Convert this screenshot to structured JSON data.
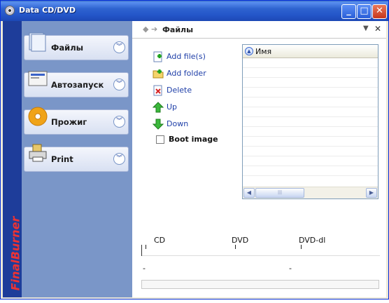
{
  "window": {
    "title": "Data CD/DVD",
    "controls": {
      "minimize": "_",
      "maximize": "□",
      "close": "✕"
    }
  },
  "brand": {
    "name": "FinalBurner",
    "strip_color": "#1e3d9a",
    "text_color": "#e33333"
  },
  "sidebar": {
    "items": [
      {
        "label": "Файлы",
        "icon": "files-icon"
      },
      {
        "label": "Автозапуск",
        "icon": "autorun-icon"
      },
      {
        "label": "Прожиг",
        "icon": "burn-disc-icon"
      },
      {
        "label": "Print",
        "icon": "printer-icon"
      }
    ]
  },
  "panel": {
    "title": "Файлы",
    "actions": [
      {
        "label": "Add file(s)",
        "icon": "add-file-icon"
      },
      {
        "label": "Add folder",
        "icon": "add-folder-icon"
      },
      {
        "label": "Delete",
        "icon": "delete-icon"
      },
      {
        "label": "Up",
        "icon": "arrow-up-icon"
      },
      {
        "label": "Down",
        "icon": "arrow-down-icon"
      }
    ],
    "boot_image": {
      "label": "Boot image",
      "checked": false
    }
  },
  "filelist": {
    "columns": [
      "Имя"
    ]
  },
  "capacity": {
    "labels": [
      "CD",
      "DVD",
      "DVD-dl"
    ],
    "left_mark": "-",
    "right_mark": "-"
  }
}
